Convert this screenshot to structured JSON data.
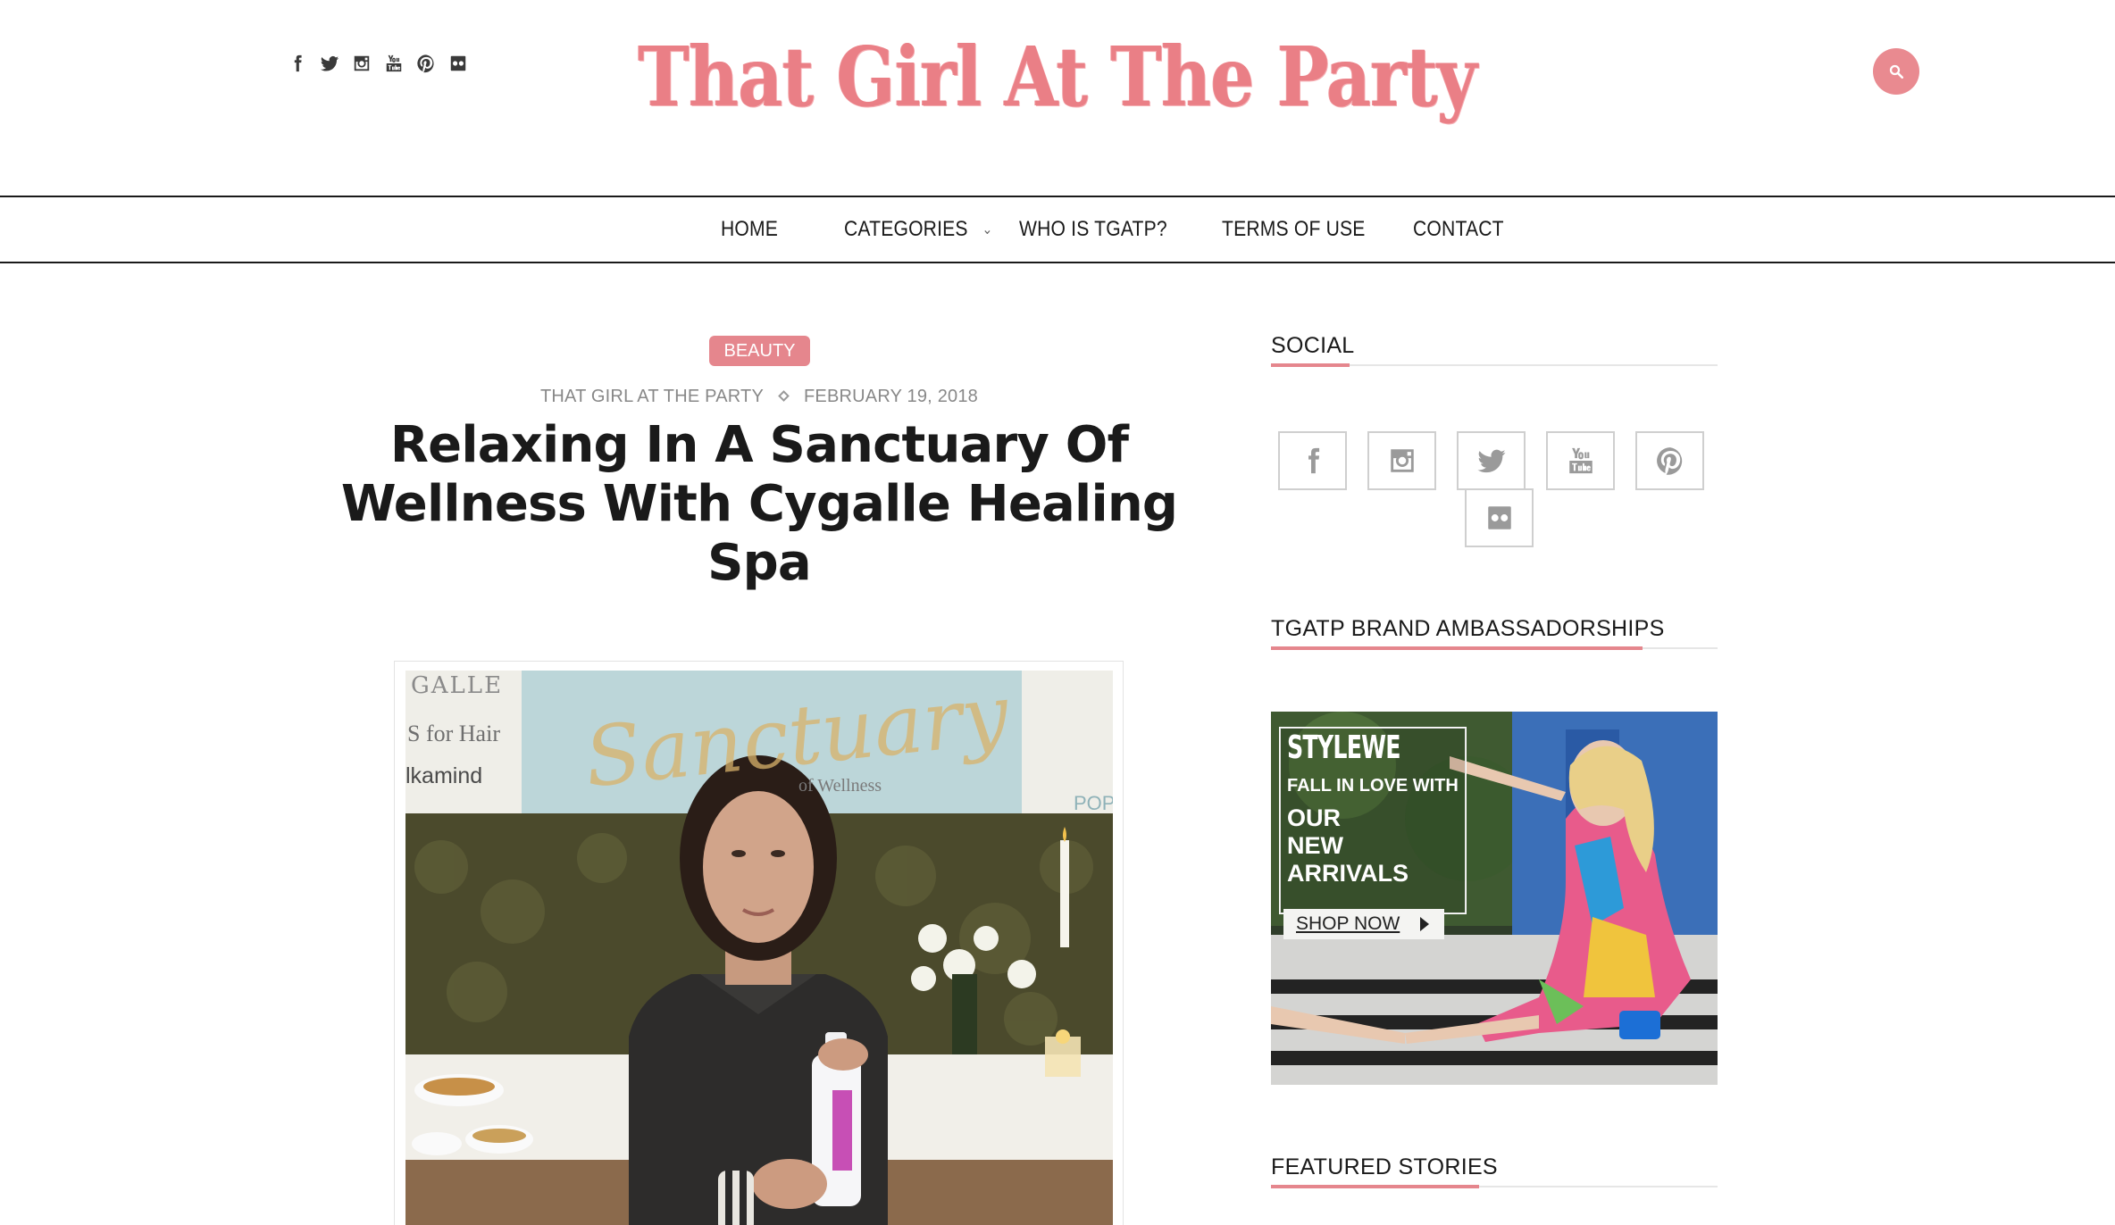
{
  "header": {
    "site_title": "That Girl At The Party",
    "social_icons": [
      "facebook-icon",
      "twitter-icon",
      "instagram-icon",
      "youtube-icon",
      "pinterest-icon",
      "flickr-icon"
    ],
    "search_icon": "search-icon"
  },
  "nav": {
    "items": [
      {
        "label": "HOME"
      },
      {
        "label": "CATEGORIES",
        "has_dropdown": true
      },
      {
        "label": "WHO IS TGATP?"
      },
      {
        "label": "TERMS OF USE"
      },
      {
        "label": "CONTACT"
      }
    ]
  },
  "article": {
    "category": "BEAUTY",
    "author": "THAT GIRL AT THE PARTY",
    "date": "FEBRUARY 19, 2018",
    "title": "Relaxing In A Sanctuary Of Wellness With Cygalle Healing Spa",
    "photo_sign": {
      "line1": "GALLE",
      "line2": "S for Hair",
      "line3": "lkamind",
      "script": "Sanctuary",
      "of": "of Wellness",
      "right1": "POP"
    }
  },
  "sidebar": {
    "social_title": "SOCIAL",
    "social_icons": [
      "facebook-icon",
      "instagram-icon",
      "twitter-icon",
      "youtube-icon",
      "pinterest-icon",
      "flickr-icon"
    ],
    "ambassador_title": "TGATP BRAND AMBASSADORSHIPS",
    "ad": {
      "brand": "STYLEWE",
      "line1": "FALL IN LOVE WITH",
      "line2": "OUR",
      "line3": "NEW",
      "line4": "ARRIVALS",
      "cta": "SHOP NOW"
    },
    "featured_title": "FEATURED STORIES"
  },
  "colors": {
    "accent_pink": "#e5868d",
    "logo_pink": "#ea7f86",
    "text_dark": "#1a1a1a",
    "meta_gray": "#888888"
  }
}
